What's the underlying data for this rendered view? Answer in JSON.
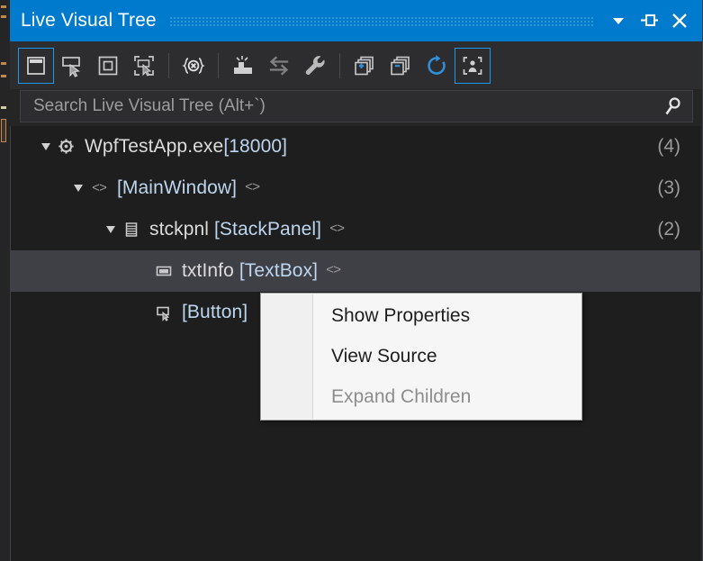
{
  "window": {
    "title": "Live Visual Tree",
    "accent_color": "#007acc",
    "titlebar_buttons": [
      {
        "name": "window-menu-dropdown",
        "icon": "chevron-down-icon",
        "label": "Window options"
      },
      {
        "name": "auto-hide-pin",
        "icon": "pin-icon",
        "label": "Auto Hide"
      },
      {
        "name": "close-window",
        "icon": "close-icon",
        "label": "Close"
      }
    ]
  },
  "toolbar": {
    "buttons": [
      {
        "name": "enable-selection-in-running-application",
        "icon": "window-select-icon",
        "label": "Enable selection in running application",
        "active": true
      },
      {
        "name": "display-layout-adorner",
        "icon": "layout-adorner-icon",
        "label": "Display layout adorner in running application",
        "active": false
      },
      {
        "name": "preview-selection",
        "icon": "preview-selection-icon",
        "label": "Preview selection",
        "active": false
      },
      {
        "name": "select-element-in-running-application",
        "icon": "element-pointer-icon",
        "label": "Select element in the running application",
        "active": false
      },
      {
        "name": "show-elements-in-source",
        "icon": "xaml-braces-icon",
        "label": "Show elements in source",
        "active": false
      },
      {
        "name": "track-focused-element",
        "icon": "track-focus-icon",
        "label": "Track focused element",
        "active": false
      },
      {
        "name": "toggle-panel",
        "icon": "swap-arrows-icon",
        "label": "Switch panel",
        "active": false
      },
      {
        "name": "settings",
        "icon": "wrench-icon",
        "label": "Settings",
        "active": false
      },
      {
        "name": "expand-all",
        "icon": "expand-all-icon",
        "label": "Expand all",
        "active": false
      },
      {
        "name": "collapse-all",
        "icon": "collapse-all-icon",
        "label": "Collapse all",
        "active": false
      },
      {
        "name": "refresh-tree",
        "icon": "refresh-icon",
        "label": "Refresh",
        "active": false
      },
      {
        "name": "show-just-my-xaml",
        "icon": "just-my-xaml-icon",
        "label": "Show just my XAML",
        "active": true
      }
    ]
  },
  "search": {
    "value": "",
    "placeholder": "Search Live Visual Tree (Alt+`)",
    "icon": "search-icon"
  },
  "tree": {
    "nodes": [
      {
        "id": "process",
        "depth": 0,
        "expander": "expanded",
        "icon": "process-gear-icon",
        "name": "WpfTestApp.exe",
        "type": "[18000]",
        "xaml_badge": false,
        "count": "(4)",
        "selected": false
      },
      {
        "id": "mainwindow",
        "depth": 1,
        "expander": "expanded",
        "icon": "xaml-element-icon",
        "name": "",
        "type": "[MainWindow]",
        "xaml_badge": true,
        "count": "(3)",
        "selected": false
      },
      {
        "id": "stckpnl",
        "depth": 2,
        "expander": "expanded",
        "icon": "stackpanel-icon",
        "name": "stckpnl ",
        "type": "[StackPanel]",
        "xaml_badge": true,
        "count": "(2)",
        "selected": false
      },
      {
        "id": "txtinfo",
        "depth": 3,
        "expander": "none",
        "icon": "textbox-icon",
        "name": "txtInfo ",
        "type": "[TextBox]",
        "xaml_badge": true,
        "count": "",
        "selected": true
      },
      {
        "id": "button",
        "depth": 3,
        "expander": "none",
        "icon": "button-icon",
        "name": "",
        "type": "[Button]",
        "xaml_badge": false,
        "count": "",
        "selected": false
      }
    ]
  },
  "context_menu": {
    "items": [
      {
        "name": "menu-show-properties",
        "label": "Show Properties",
        "disabled": false
      },
      {
        "name": "menu-view-source",
        "label": "View Source",
        "disabled": false
      },
      {
        "name": "menu-expand-children",
        "label": "Expand Children",
        "disabled": true
      }
    ]
  }
}
